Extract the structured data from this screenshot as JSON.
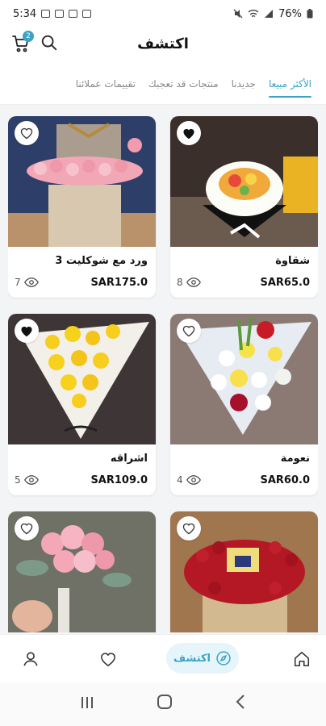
{
  "status_bar": {
    "time": "5:34",
    "battery": "76%"
  },
  "header": {
    "title": "اكتشف",
    "cart_count": "2"
  },
  "tabs": [
    {
      "label": "الأكثر مبيعا",
      "active": true
    },
    {
      "label": "جديدنا",
      "active": false
    },
    {
      "label": "منتجات قد تعجبك",
      "active": false
    },
    {
      "label": "تقييمات عملائنا",
      "active": false
    }
  ],
  "products": [
    {
      "name": "شقاوة",
      "price": "SAR65.0",
      "views": "8",
      "favorite": true
    },
    {
      "name": "ورد مع شوكليت 3",
      "price": "SAR175.0",
      "views": "7",
      "favorite": false
    },
    {
      "name": "نعومة",
      "price": "SAR60.0",
      "views": "4",
      "favorite": false
    },
    {
      "name": "اشراقه",
      "price": "SAR109.0",
      "views": "5",
      "favorite": true
    },
    {
      "name": "",
      "price": "",
      "views": "",
      "favorite": false
    },
    {
      "name": "",
      "price": "",
      "views": "",
      "favorite": false
    }
  ],
  "bottom_nav": {
    "active_label": "اكتشف"
  },
  "colors": {
    "accent": "#3aa3c7",
    "accent_light": "#e5f5fa"
  }
}
